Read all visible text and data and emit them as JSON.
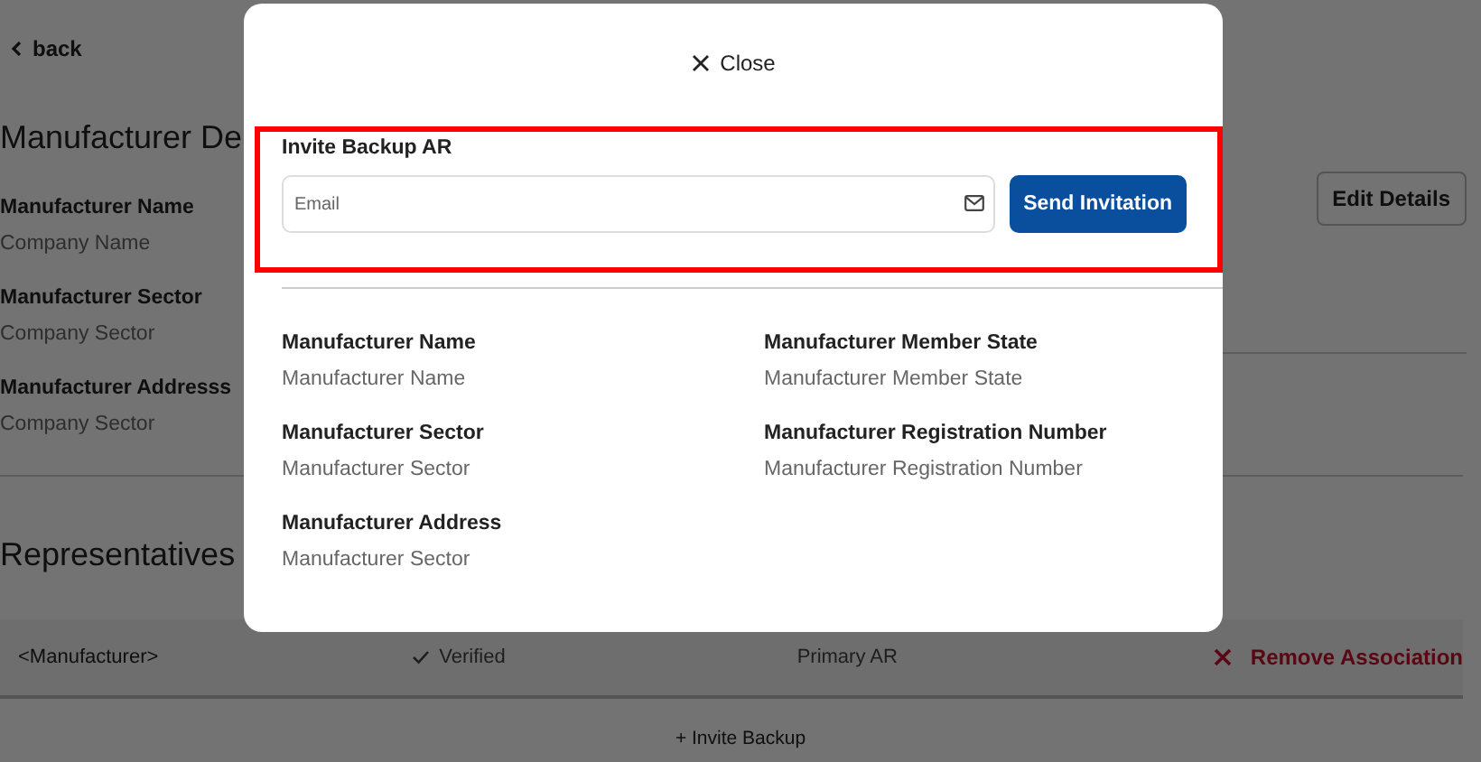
{
  "page": {
    "back_link": "back",
    "title": "Manufacturer De",
    "edit_button": "Edit Details",
    "fields": [
      {
        "label": "Manufacturer Name",
        "value": "Company Name"
      },
      {
        "label": "Manufacturer Sector",
        "value": "Company Sector"
      },
      {
        "label": "Manufacturer Addresss",
        "value": "Company Sector"
      }
    ],
    "section_title": "Representatives",
    "representatives": [
      {
        "name": "<Manufacturer>",
        "status": "Verified",
        "role": "Primary AR",
        "action": "Remove Association"
      }
    ],
    "invite_link": "+ Invite Backup"
  },
  "modal": {
    "close": "Close",
    "invite": {
      "title": "Invite Backup AR",
      "placeholder": "Email",
      "send_button": "Send Invitation"
    },
    "details": [
      {
        "label": "Manufacturer Name",
        "value": "Manufacturer Name"
      },
      {
        "label": "Manufacturer Member State",
        "value": "Manufacturer Member State"
      },
      {
        "label": "Manufacturer Sector",
        "value": "Manufacturer Sector"
      },
      {
        "label": "Manufacturer Registration Number",
        "value": "Manufacturer Registration Number"
      },
      {
        "label": "Manufacturer Address",
        "value": "Manufacturer Sector"
      }
    ]
  }
}
